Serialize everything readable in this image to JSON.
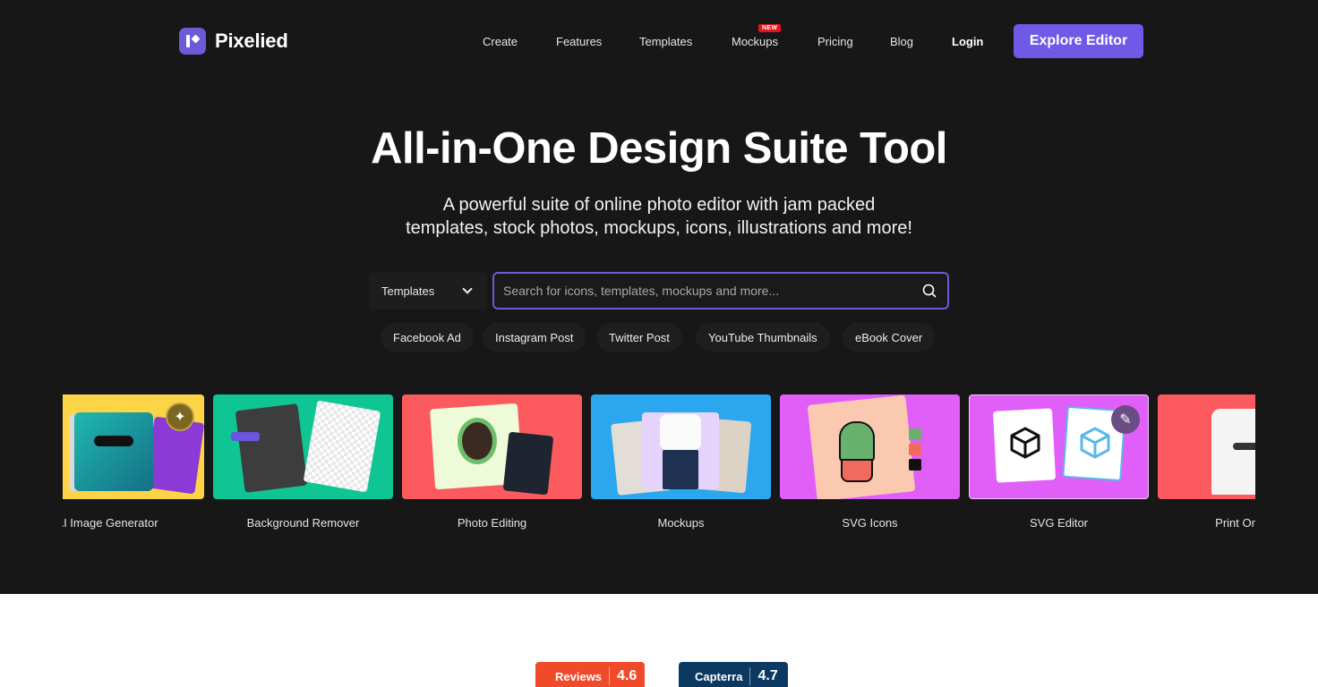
{
  "brand": {
    "name": "Pixelied",
    "accent": "#6e5ae6"
  },
  "nav": {
    "items": [
      {
        "label": "Create"
      },
      {
        "label": "Features"
      },
      {
        "label": "Templates"
      },
      {
        "label": "Mockups",
        "badge": "NEW"
      },
      {
        "label": "Pricing"
      },
      {
        "label": "Blog"
      }
    ],
    "login": "Login",
    "cta": "Explore Editor"
  },
  "hero": {
    "title": "All-in-One Design Suite Tool",
    "subtitle_line1": "A powerful suite of online photo editor with jam packed",
    "subtitle_line2": "templates, stock photos, mockups, icons, illustrations and more!"
  },
  "search": {
    "category": "Templates",
    "placeholder": "Search for icons, templates, mockups and more...",
    "value": ""
  },
  "chips": [
    "Facebook Ad",
    "Instagram Post",
    "Twitter Post",
    "YouTube Thumbnails",
    "eBook Cover"
  ],
  "cards": [
    {
      "label": "AI Image Generator",
      "color": "#fed447"
    },
    {
      "label": "Background Remover",
      "color": "#10c594"
    },
    {
      "label": "Photo Editing",
      "color": "#fb5b5e"
    },
    {
      "label": "Mockups",
      "color": "#2aa7ef"
    },
    {
      "label": "SVG Icons",
      "color": "#e05ff8"
    },
    {
      "label": "SVG Editor",
      "color": "#e05ff8"
    },
    {
      "label": "Print On D",
      "color": "#fb5b5e"
    }
  ],
  "reviews": [
    {
      "name": "Reviews",
      "score": "4.6",
      "color": "#ef4a2a"
    },
    {
      "name": "Capterra",
      "score": "4.7",
      "color": "#0c3962"
    }
  ]
}
